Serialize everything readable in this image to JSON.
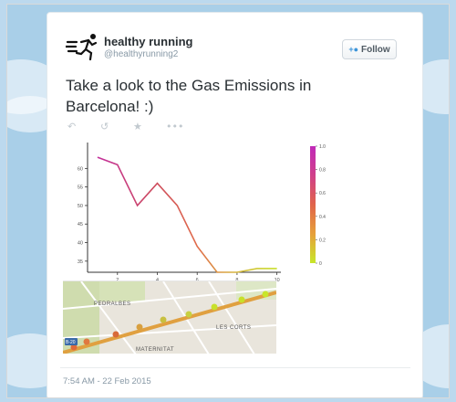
{
  "tweet": {
    "display_name": "healthy running",
    "handle": "@healthyrunning2",
    "follow_label": "Follow",
    "text": "Take a look to the Gas Emissions in Barcelona! :)",
    "timestamp": "7:54 AM - 22 Feb 2015",
    "actions": [
      "reply-icon",
      "retweet-icon",
      "favorite-icon",
      "more-icon"
    ]
  },
  "colors": {
    "name": "#292f33",
    "muted": "#8899a6",
    "follow_icon": "#3b94d9",
    "line_high": "#c41e9a",
    "line_low": "#c4e02c"
  },
  "map": {
    "labels": [
      "PEDRALBES",
      "LES CORTS",
      "MATERNITAT",
      "B-20"
    ]
  },
  "chart_data": {
    "type": "line",
    "x": [
      1,
      2,
      3,
      4,
      5,
      6,
      7,
      8,
      9,
      10
    ],
    "values": [
      63,
      61,
      50,
      56,
      50,
      39,
      32,
      32,
      33,
      33
    ],
    "xticks": [
      2,
      4,
      6,
      8,
      10
    ],
    "yticks": [
      35,
      40,
      45,
      50,
      55,
      60
    ],
    "xlim": [
      0.5,
      10.2
    ],
    "ylim": [
      32,
      66
    ],
    "grid": false,
    "colorbar": {
      "ticks": [
        "0",
        "0.2",
        "0.4",
        "0.6",
        "0.8",
        "1.0"
      ],
      "colors": [
        "#c8e62a",
        "#e6a03a",
        "#e0644a",
        "#d8406a",
        "#c43aa0",
        "#c02ab8"
      ]
    }
  }
}
